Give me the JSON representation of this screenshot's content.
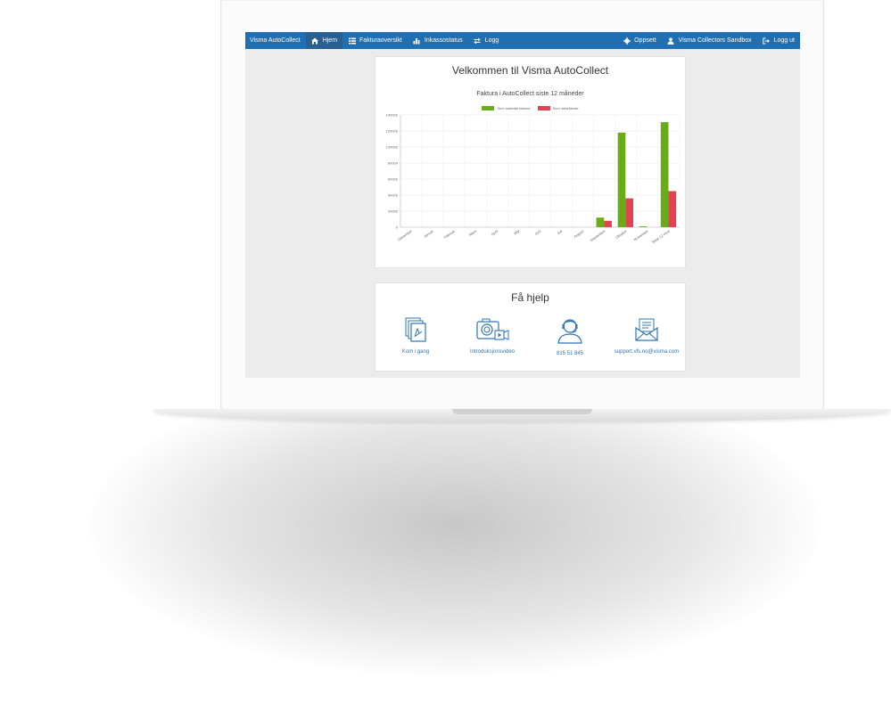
{
  "nav": {
    "brand": "Visma AutoCollect",
    "items": [
      {
        "label": "Hjem",
        "icon": "home-icon",
        "active": true
      },
      {
        "label": "Fakturaoversikt",
        "icon": "list-icon",
        "active": false
      },
      {
        "label": "Inkassostatus",
        "icon": "bar-chart-icon",
        "active": false
      },
      {
        "label": "Logg",
        "icon": "swap-icon",
        "active": false
      }
    ],
    "right": [
      {
        "label": "Oppsett",
        "icon": "gear-icon"
      },
      {
        "label": "Visma Collectors Sandbox",
        "icon": "user-icon"
      },
      {
        "label": "Logg ut",
        "icon": "logout-icon"
      }
    ],
    "color": "#1f6fb2"
  },
  "welcome": {
    "title": "Velkommen til Visma AutoCollect"
  },
  "chart_data": {
    "type": "bar",
    "title": "Fakturа i AutoCollect siste 12 måneder",
    "categories": [
      "Desember",
      "Januar",
      "Februar",
      "Mars",
      "April",
      "Mai",
      "Juni",
      "Juli",
      "August",
      "September",
      "Oktober",
      "November",
      "Siste 12 mnd"
    ],
    "series": [
      {
        "name": "Sum mottatte faktura",
        "color": "#6aab18",
        "values": [
          0,
          0,
          0,
          0,
          0,
          0,
          0,
          0,
          0,
          12000,
          118000,
          1000,
          131000
        ]
      },
      {
        "name": "Sum utestående",
        "color": "#e04351",
        "values": [
          0,
          0,
          0,
          0,
          0,
          0,
          0,
          0,
          0,
          8000,
          36000,
          0,
          45000
        ]
      }
    ],
    "ylim": [
      0,
      140000
    ],
    "yticks": [
      "0",
      "20000",
      "40000",
      "60000",
      "80000",
      "100000",
      "120000",
      "140000"
    ],
    "grid": true,
    "legend": "top"
  },
  "help": {
    "title": "Få hjelp",
    "items": [
      {
        "label": "Kom i gang",
        "icon": "pdf-document-icon"
      },
      {
        "label": "Introduksjonsvideo",
        "icon": "video-camera-icon"
      },
      {
        "label": "815 51 845",
        "icon": "support-agent-icon"
      },
      {
        "label": "support.vfs.no@visma.com",
        "icon": "envelope-icon"
      }
    ],
    "color": "#2e75b6"
  }
}
